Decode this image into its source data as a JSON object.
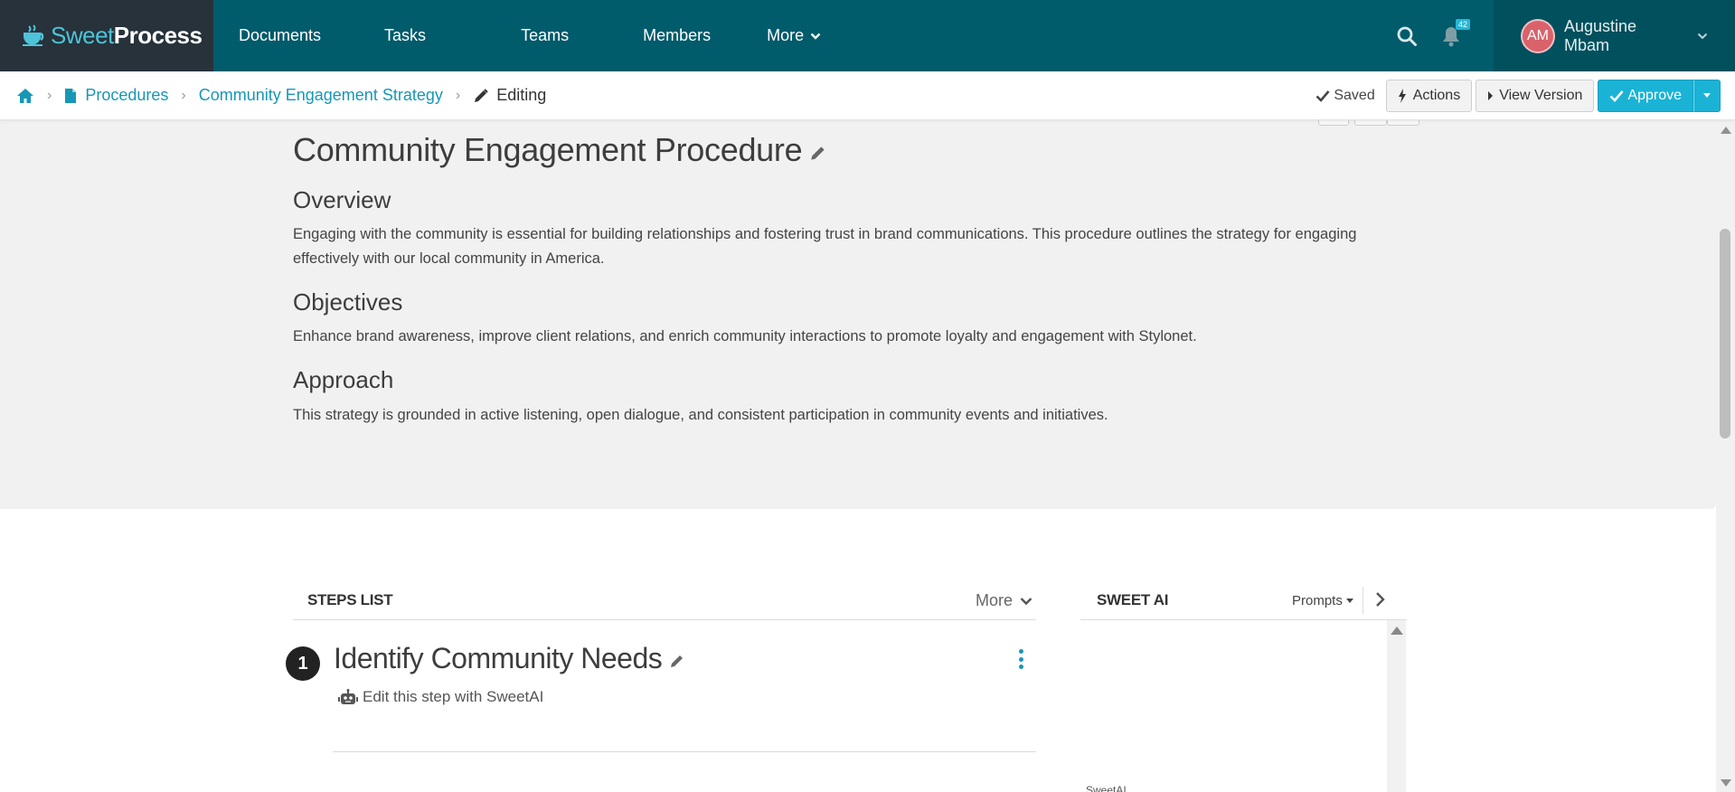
{
  "brand": {
    "name_part1": "Sweet",
    "name_part2": "Process"
  },
  "nav": {
    "items": [
      {
        "label": "Documents"
      },
      {
        "label": "Tasks"
      },
      {
        "label": "Teams"
      },
      {
        "label": "Members"
      },
      {
        "label": "More"
      }
    ],
    "notification_count": "42",
    "user": {
      "initials": "AM",
      "name": "Augustine Mbam"
    }
  },
  "breadcrumb": {
    "procedures": "Procedures",
    "parent": "Community Engagement Strategy",
    "current": "Editing"
  },
  "toolbar": {
    "saved_label": "Saved",
    "actions_label": "Actions",
    "view_version_label": "View Version",
    "approve_label": "Approve"
  },
  "document": {
    "title": "Community Engagement Procedure",
    "sections": [
      {
        "heading": "Overview",
        "body": "Engaging with the community is essential for building relationships and fostering trust in brand communications. This procedure outlines the strategy for engaging effectively with our local community in America."
      },
      {
        "heading": "Objectives",
        "body": "Enhance brand awareness, improve client relations, and enrich community interactions to promote loyalty and engagement with Stylonet."
      },
      {
        "heading": "Approach",
        "body": "This strategy is grounded in active listening, open dialogue, and consistent participation in community events and initiatives."
      }
    ]
  },
  "steps_list": {
    "title": "STEPS LIST",
    "more_label": "More",
    "steps": [
      {
        "number": "1",
        "title": "Identify Community Needs",
        "ai_link": "Edit this step with SweetAI"
      }
    ]
  },
  "sweet_ai": {
    "title": "SWEET AI",
    "prompts_label": "Prompts",
    "footer_label": "SweetAI"
  },
  "colors": {
    "navbar": "#005b6b",
    "logo_bg": "#27323a",
    "accent": "#1797b7",
    "approve": "#1ab3d6",
    "panel_bg": "#f1f1f1"
  }
}
